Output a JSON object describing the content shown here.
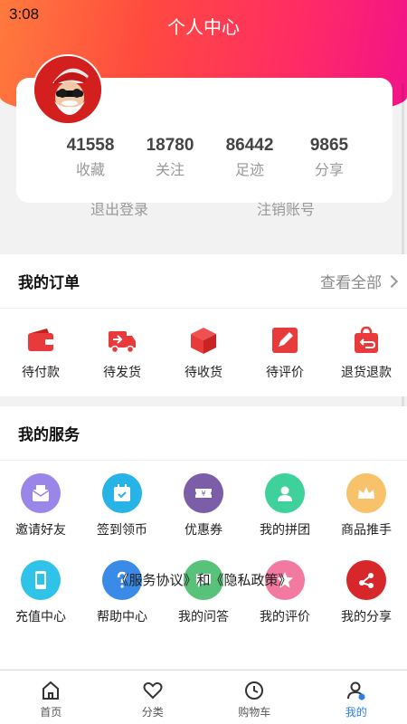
{
  "status_bar": {
    "time": "3:08"
  },
  "header": {
    "title": "个人中心"
  },
  "profile": {
    "avatar_icon": "santa-avatar",
    "stats": [
      {
        "value": "41558",
        "label": "收藏"
      },
      {
        "value": "18780",
        "label": "关注"
      },
      {
        "value": "86442",
        "label": "足迹"
      },
      {
        "value": "9865",
        "label": "分享"
      }
    ],
    "logout_label": "退出登录",
    "cancel_account_label": "注销账号"
  },
  "orders": {
    "title": "我的订单",
    "view_all": "查看全部",
    "items": [
      {
        "label": "待付款",
        "icon": "wallet-icon"
      },
      {
        "label": "待发货",
        "icon": "delivery-truck-icon"
      },
      {
        "label": "待收货",
        "icon": "package-box-icon"
      },
      {
        "label": "待评价",
        "icon": "edit-review-icon"
      },
      {
        "label": "退货退款",
        "icon": "return-bag-icon"
      }
    ]
  },
  "services": {
    "title": "我的服务",
    "items": [
      {
        "label": "邀请好友",
        "icon": "invite-mail-icon",
        "color": "#9a86e8"
      },
      {
        "label": "签到领币",
        "icon": "calendar-check-icon",
        "color": "#27b3e6"
      },
      {
        "label": "优惠券",
        "icon": "coupon-icon",
        "color": "#7b5ea7"
      },
      {
        "label": "我的拼团",
        "icon": "group-user-icon",
        "color": "#3ed19c"
      },
      {
        "label": "商品推手",
        "icon": "crown-icon",
        "color": "#f7c26a"
      },
      {
        "label": "充值中心",
        "icon": "phone-icon",
        "color": "#2fc3ea"
      },
      {
        "label": "帮助中心",
        "icon": "help-icon",
        "color": "#3a8be8"
      },
      {
        "label": "我的问答",
        "icon": "qa-icon",
        "color": "#59c27a"
      },
      {
        "label": "我的评价",
        "icon": "review-icon",
        "color": "#f27aa0"
      },
      {
        "label": "我的分享",
        "icon": "share-icon",
        "color": "#d8272b"
      }
    ]
  },
  "agreement_text": "《服务协议》和《隐私政策》",
  "tabbar": {
    "items": [
      {
        "label": "首页",
        "icon": "home-icon"
      },
      {
        "label": "分类",
        "icon": "heart-icon"
      },
      {
        "label": "购物车",
        "icon": "clock-icon"
      },
      {
        "label": "我的",
        "icon": "user-icon",
        "active": true
      }
    ]
  },
  "colors": {
    "accent_red": "#e83a3a",
    "tab_active": "#2b7de9",
    "header_start": "#ff7a3d",
    "header_end": "#f2128a"
  }
}
